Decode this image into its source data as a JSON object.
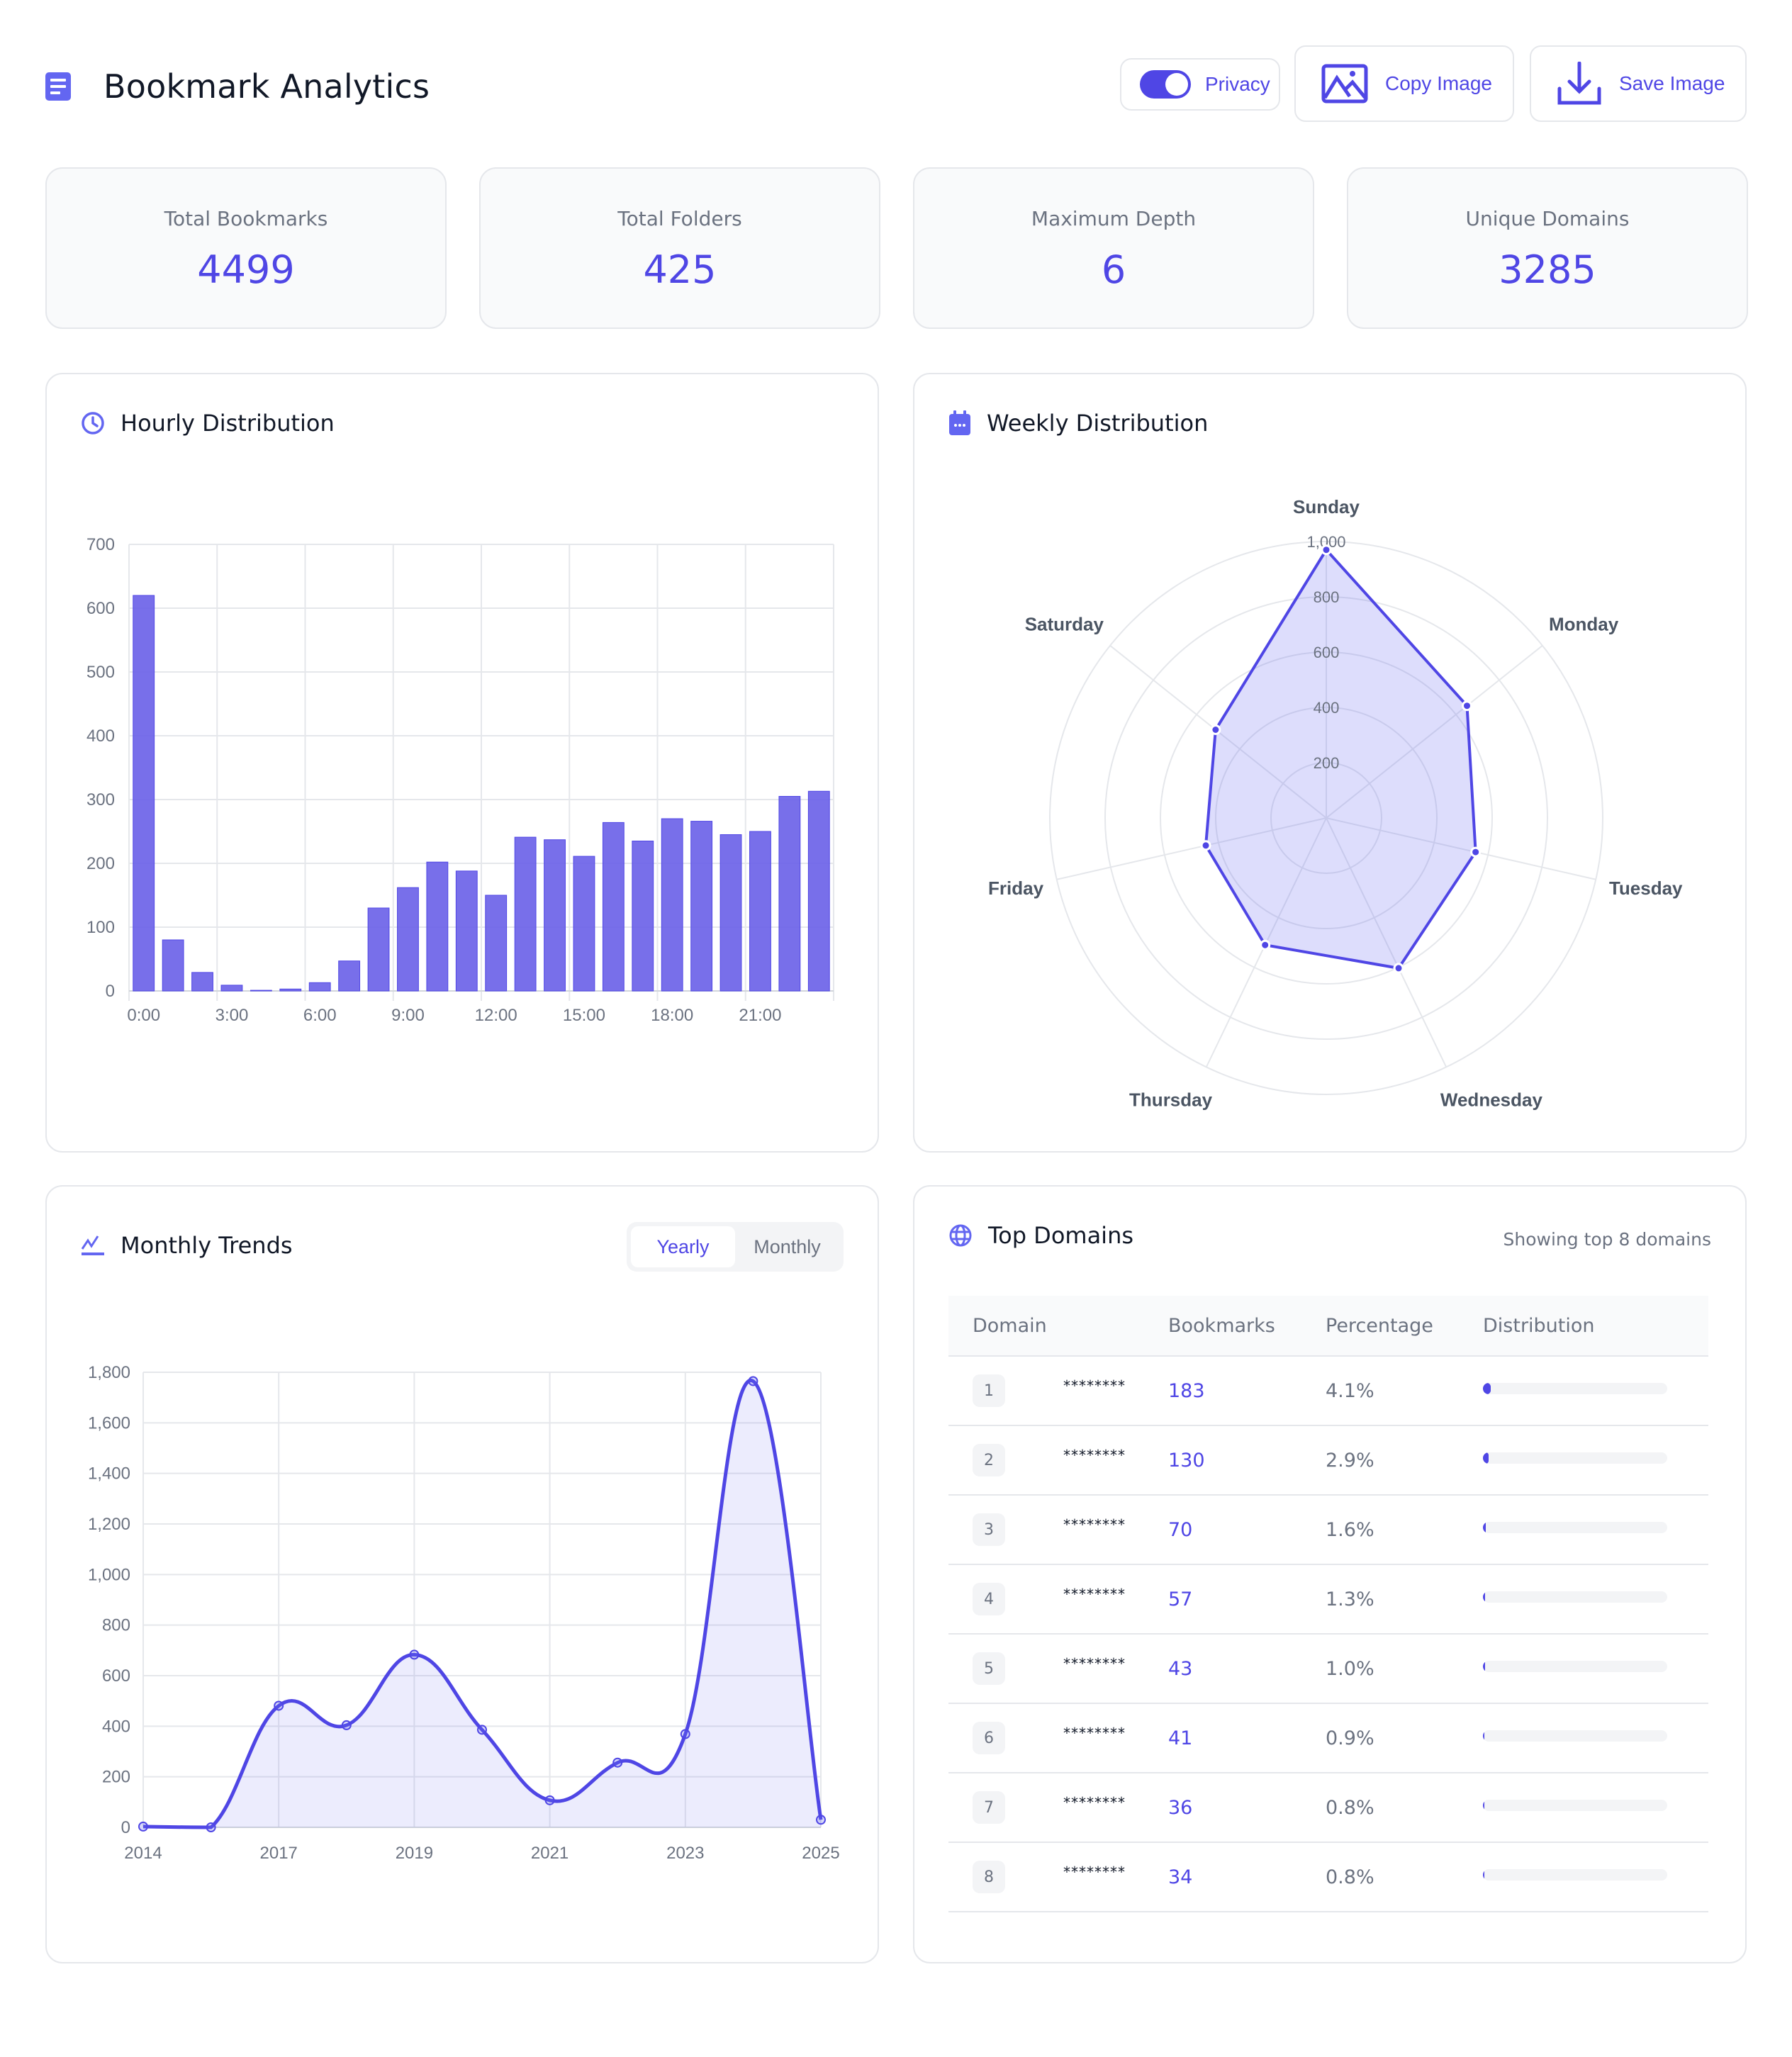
{
  "header": {
    "title": "Bookmark Analytics",
    "privacy_label": "Privacy",
    "privacy_on": true,
    "copy_label": "Copy Image",
    "save_label": "Save Image",
    "accent": "#4f46e5"
  },
  "stats": [
    {
      "label": "Total Bookmarks",
      "value": "4499"
    },
    {
      "label": "Total Folders",
      "value": "425"
    },
    {
      "label": "Maximum Depth",
      "value": "6"
    },
    {
      "label": "Unique Domains",
      "value": "3285"
    }
  ],
  "hourly": {
    "title": "Hourly Distribution"
  },
  "weekly": {
    "title": "Weekly Distribution"
  },
  "trends": {
    "title": "Monthly Trends",
    "toggle": [
      "Yearly",
      "Monthly"
    ],
    "active": "Yearly"
  },
  "domains": {
    "title": "Top Domains",
    "subtitle": "Showing top 8 domains",
    "headers": [
      "Domain",
      "Bookmarks",
      "Percentage",
      "Distribution"
    ],
    "rows": [
      {
        "rank": "1",
        "domain": "********",
        "count": "183",
        "pct": "4.1%",
        "share": 4.1
      },
      {
        "rank": "2",
        "domain": "********",
        "count": "130",
        "pct": "2.9%",
        "share": 2.9
      },
      {
        "rank": "3",
        "domain": "********",
        "count": "70",
        "pct": "1.6%",
        "share": 1.6
      },
      {
        "rank": "4",
        "domain": "********",
        "count": "57",
        "pct": "1.3%",
        "share": 1.3
      },
      {
        "rank": "5",
        "domain": "********",
        "count": "43",
        "pct": "1.0%",
        "share": 1.0
      },
      {
        "rank": "6",
        "domain": "********",
        "count": "41",
        "pct": "0.9%",
        "share": 0.9
      },
      {
        "rank": "7",
        "domain": "********",
        "count": "36",
        "pct": "0.8%",
        "share": 0.8
      },
      {
        "rank": "8",
        "domain": "********",
        "count": "34",
        "pct": "0.8%",
        "share": 0.8
      }
    ]
  },
  "chart_data": [
    {
      "type": "bar",
      "title": "Hourly Distribution",
      "categories": [
        "0:00",
        "1:00",
        "2:00",
        "3:00",
        "4:00",
        "5:00",
        "6:00",
        "7:00",
        "8:00",
        "9:00",
        "10:00",
        "11:00",
        "12:00",
        "13:00",
        "14:00",
        "15:00",
        "16:00",
        "17:00",
        "18:00",
        "19:00",
        "20:00",
        "21:00",
        "22:00",
        "23:00"
      ],
      "tick_labels": [
        "0:00",
        "3:00",
        "6:00",
        "9:00",
        "12:00",
        "15:00",
        "18:00",
        "21:00"
      ],
      "values": [
        620,
        80,
        29,
        9,
        1,
        3,
        13,
        47,
        130,
        162,
        202,
        188,
        150,
        241,
        237,
        211,
        264,
        235,
        270,
        266,
        245,
        250,
        305,
        313
      ],
      "ylim": [
        0,
        700
      ],
      "yticks": [
        0,
        100,
        200,
        300,
        400,
        500,
        600,
        700
      ],
      "grid": true,
      "color": "#6c63e8"
    },
    {
      "type": "radar",
      "title": "Weekly Distribution",
      "categories": [
        "Sunday",
        "Monday",
        "Tuesday",
        "Wednesday",
        "Thursday",
        "Friday",
        "Saturday"
      ],
      "values": [
        970,
        651,
        554,
        603,
        510,
        447,
        512
      ],
      "rlim": [
        0,
        1000
      ],
      "rticks": [
        "200",
        "400",
        "600",
        "800",
        "1,000"
      ],
      "color": "#4f46e5"
    },
    {
      "type": "area",
      "title": "Monthly Trends",
      "x": [
        "2014",
        "2016",
        "2017",
        "2018",
        "2019",
        "2020",
        "2021",
        "2022",
        "2023",
        "2024",
        "2025"
      ],
      "tick_labels": [
        "2014",
        "",
        "2017",
        "",
        "2019",
        "",
        "2021",
        "",
        "2023",
        "",
        "2025"
      ],
      "values": [
        3,
        0,
        481,
        404,
        683,
        386,
        107,
        256,
        369,
        1765,
        30
      ],
      "ylim": [
        0,
        1800
      ],
      "yticks": [
        "0",
        "200",
        "400",
        "600",
        "800",
        "1,000",
        "1,200",
        "1,400",
        "1,600",
        "1,800"
      ],
      "grid": true,
      "color": "#4f46e5"
    }
  ]
}
